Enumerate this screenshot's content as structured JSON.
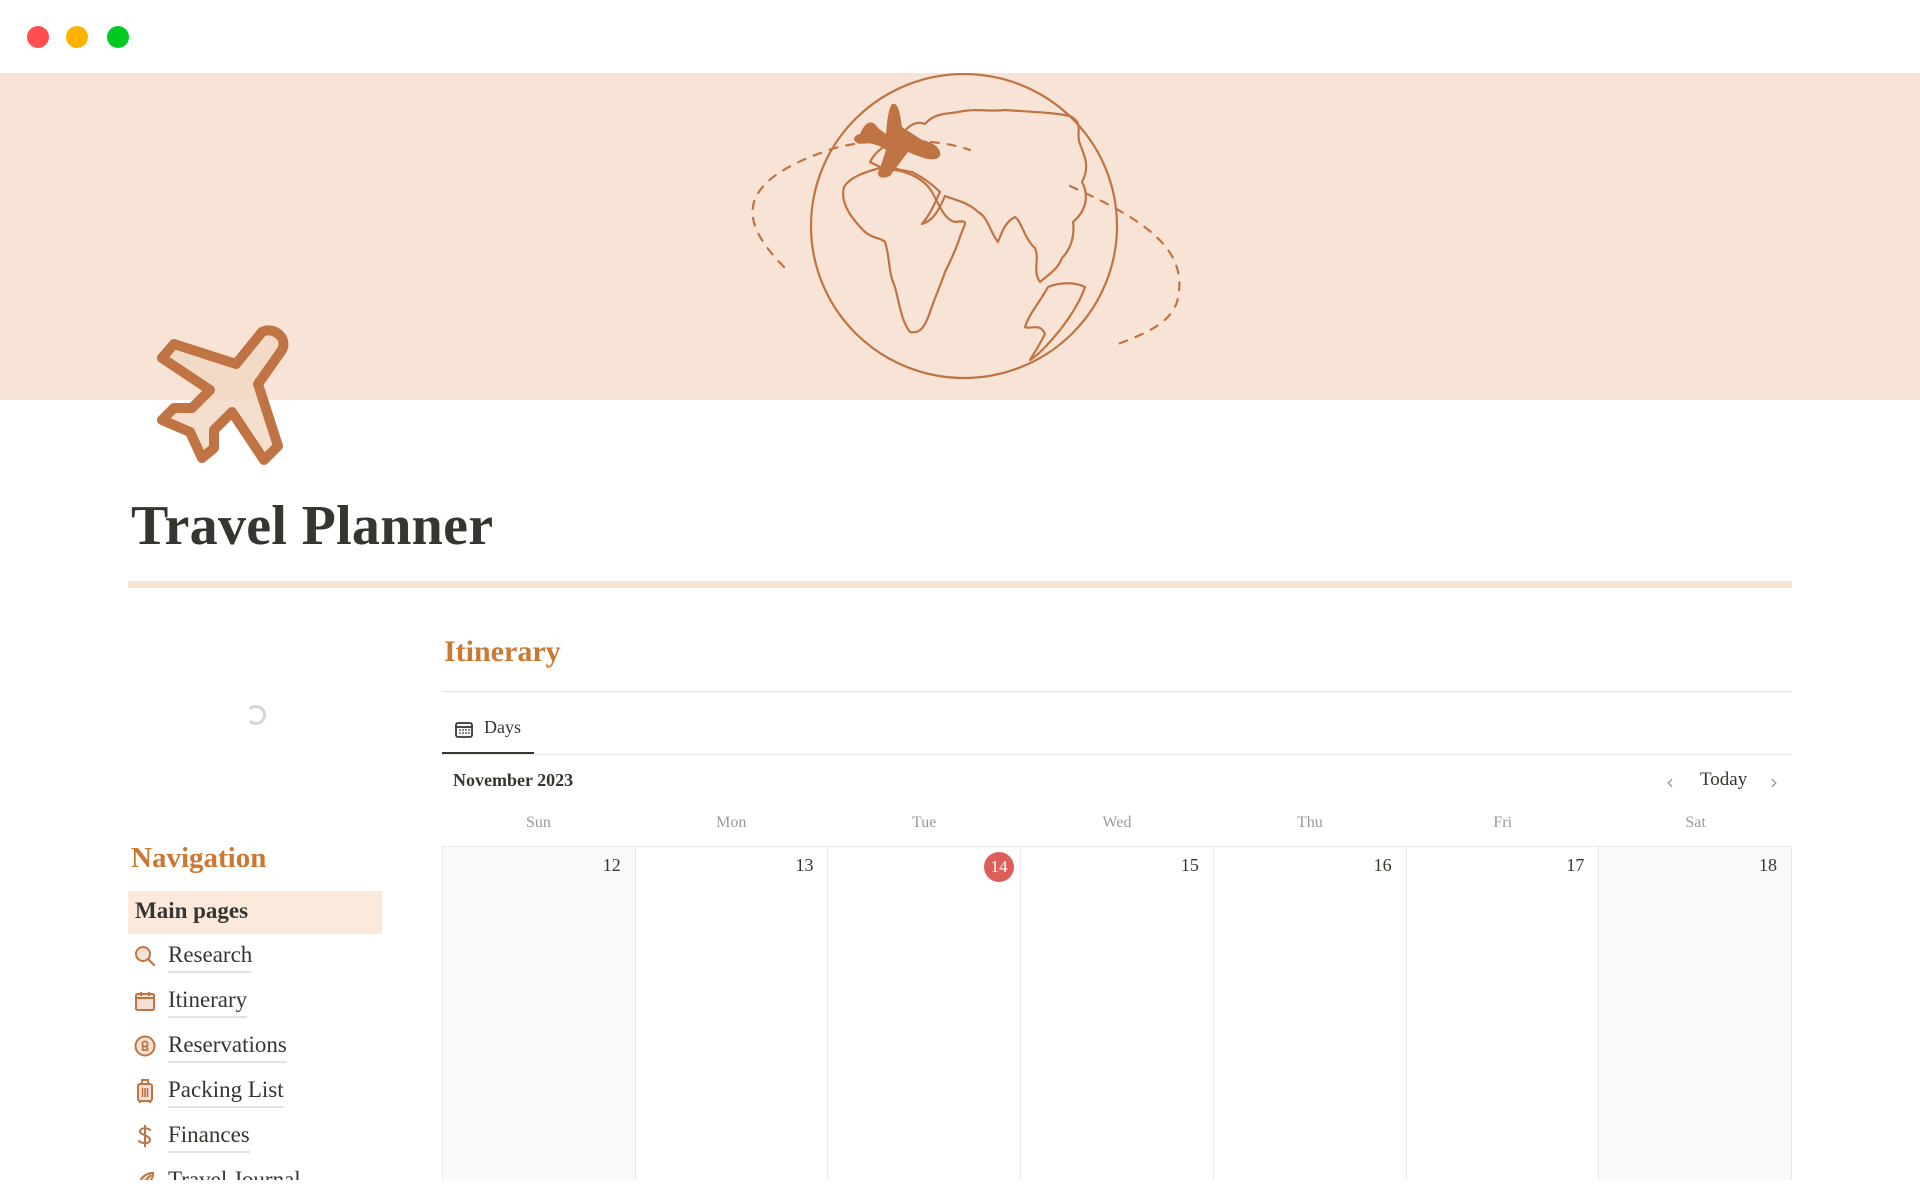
{
  "window": {
    "controls": [
      "close",
      "minimize",
      "maximize"
    ]
  },
  "page": {
    "title": "Travel Planner",
    "icon": "airplane-icon",
    "cover": "globe-with-airplane-illustration"
  },
  "colors": {
    "accent": "#cd7832",
    "banner": "#f7e4d6",
    "today": "#dc5f5c",
    "text": "#37352f"
  },
  "navigation": {
    "heading": "Navigation",
    "section": "Main pages",
    "items": [
      {
        "label": "Research",
        "icon": "magnifier-icon"
      },
      {
        "label": "Itinerary",
        "icon": "calendar-icon"
      },
      {
        "label": "Reservations",
        "icon": "keyhole-icon"
      },
      {
        "label": "Packing List",
        "icon": "luggage-icon"
      },
      {
        "label": "Finances",
        "icon": "dollar-icon"
      },
      {
        "label": "Travel Journal",
        "icon": "feather-icon"
      }
    ]
  },
  "itinerary": {
    "heading": "Itinerary",
    "tabs": [
      {
        "label": "Days",
        "icon": "calendar-icon",
        "active": true
      }
    ],
    "calendar": {
      "month_label": "November 2023",
      "today_label": "Today",
      "prev_label": "‹",
      "next_label": "›",
      "weekdays": [
        "Sun",
        "Mon",
        "Tue",
        "Wed",
        "Thu",
        "Fri",
        "Sat"
      ],
      "days": [
        {
          "num": "12",
          "weekend": true,
          "today": false
        },
        {
          "num": "13",
          "weekend": false,
          "today": false
        },
        {
          "num": "14",
          "weekend": false,
          "today": true
        },
        {
          "num": "15",
          "weekend": false,
          "today": false
        },
        {
          "num": "16",
          "weekend": false,
          "today": false
        },
        {
          "num": "17",
          "weekend": false,
          "today": false
        },
        {
          "num": "18",
          "weekend": true,
          "today": false
        }
      ]
    }
  }
}
